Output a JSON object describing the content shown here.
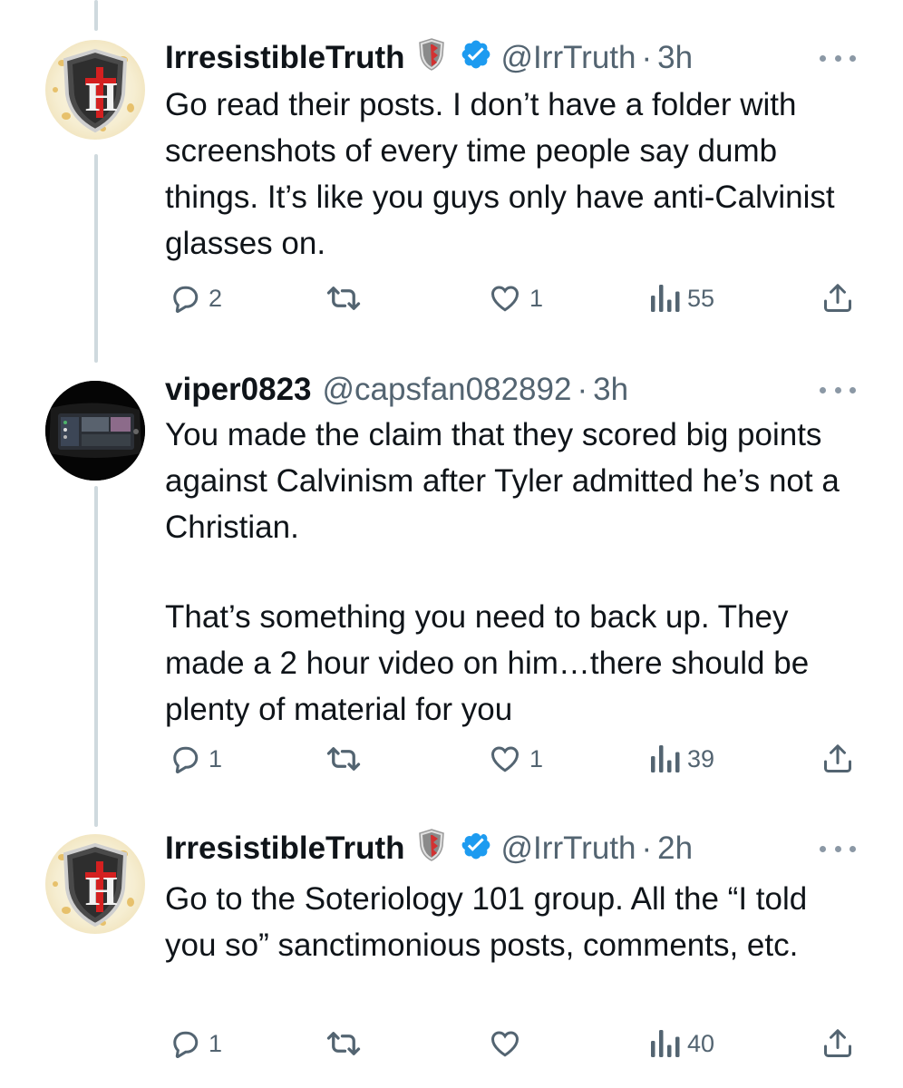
{
  "tweets": [
    {
      "display_name": "IrresistibleTruth",
      "handle": "@IrrTruth",
      "separator": "·",
      "time": "3h",
      "text": [
        "Go read their posts. I don’t have a folder with screenshots of every time people say dumb things.  It’s like you guys only have anti-Calvinist glasses on."
      ],
      "replies": "2",
      "retweets": "",
      "likes": "1",
      "views": "55"
    },
    {
      "display_name": "viper0823",
      "handle": "@capsfan082892",
      "separator": "·",
      "time": "3h",
      "text": [
        "You made the claim that they scored big points against Calvinism after Tyler admitted he’s not a Christian.",
        "That’s something you need to back up.  They made a 2 hour video on him…there should be plenty of material for you"
      ],
      "replies": "1",
      "retweets": "",
      "likes": "1",
      "views": "39"
    },
    {
      "display_name": "IrresistibleTruth",
      "handle": "@IrrTruth",
      "separator": "·",
      "time": "2h",
      "text": [
        "Go to the Soteriology 101 group.  All the “I told you so” sanctimonious posts, comments, etc."
      ],
      "replies": "1",
      "retweets": "",
      "likes": "",
      "views": "40"
    }
  ],
  "avatar_text": "H",
  "colors": {
    "text": "#0f1419",
    "muted": "#536471",
    "verified": "#1d9bf0",
    "thread_line": "#cfd9de"
  },
  "icons": [
    "reply-icon",
    "retweet-icon",
    "like-icon",
    "views-icon",
    "share-icon",
    "more-icon",
    "verified-icon",
    "shield-badge-icon"
  ]
}
